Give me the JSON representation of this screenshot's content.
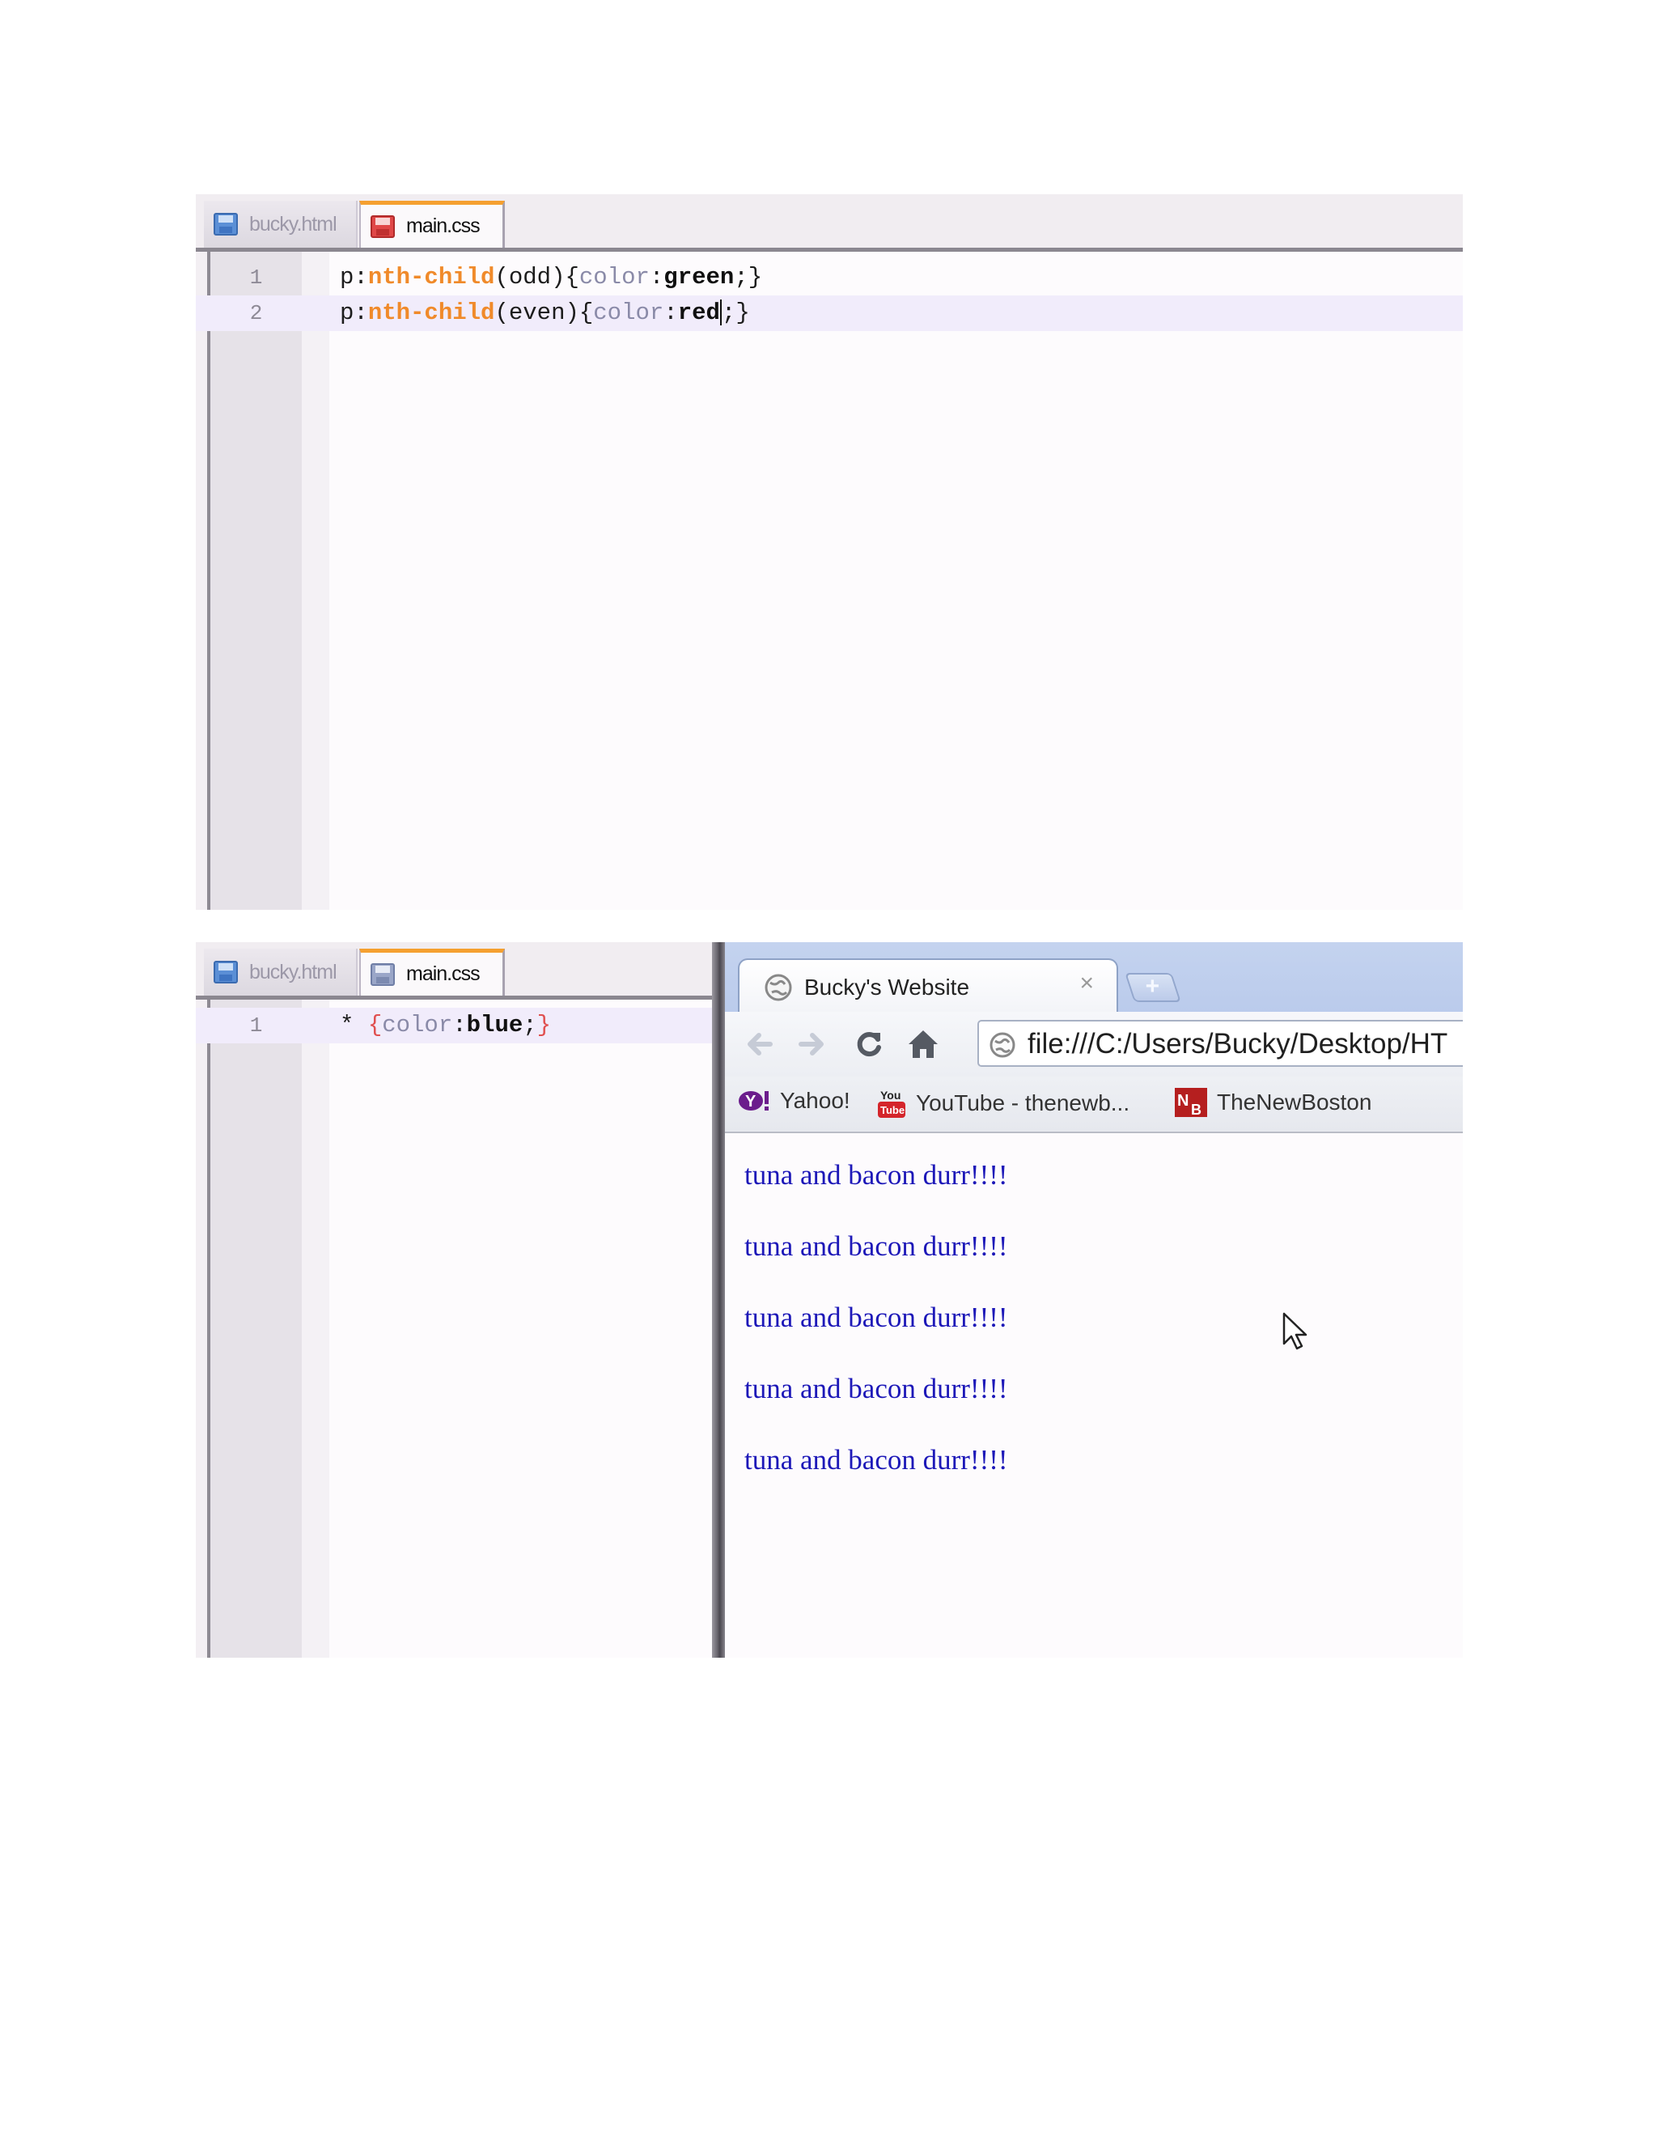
{
  "top_editor": {
    "tabs": [
      {
        "label": "bucky.html",
        "active": false
      },
      {
        "label": "main.css",
        "active": true
      }
    ],
    "lines": [
      {
        "number": "1",
        "tokens": [
          {
            "t": "p:",
            "c": "sel"
          },
          {
            "t": "nth-child",
            "c": "pseudo"
          },
          {
            "t": "(odd)",
            "c": "paren"
          },
          {
            "t": "{",
            "c": "brace"
          },
          {
            "t": "color",
            "c": "prop"
          },
          {
            "t": ":",
            "c": "sel"
          },
          {
            "t": "green",
            "c": "val"
          },
          {
            "t": ";}",
            "c": "sel"
          }
        ]
      },
      {
        "number": "2",
        "tokens": [
          {
            "t": "p:",
            "c": "sel"
          },
          {
            "t": "nth-child",
            "c": "pseudo"
          },
          {
            "t": "(even)",
            "c": "paren"
          },
          {
            "t": "{",
            "c": "brace"
          },
          {
            "t": "color",
            "c": "prop"
          },
          {
            "t": ":",
            "c": "sel"
          },
          {
            "t": "red",
            "c": "val"
          },
          {
            "t": "|",
            "c": "caret"
          },
          {
            "t": ";}",
            "c": "sel"
          }
        ]
      }
    ]
  },
  "bottom_editor": {
    "tabs": [
      {
        "label": "bucky.html",
        "active": false
      },
      {
        "label": "main.css",
        "active": true
      }
    ],
    "lines": [
      {
        "number": "1",
        "tokens": [
          {
            "t": "* ",
            "c": "sel"
          },
          {
            "t": "{",
            "c": "bracered"
          },
          {
            "t": "color",
            "c": "prop"
          },
          {
            "t": ":",
            "c": "sel"
          },
          {
            "t": "blue",
            "c": "val"
          },
          {
            "t": ";",
            "c": "sel"
          },
          {
            "t": "}",
            "c": "bracered"
          }
        ]
      }
    ]
  },
  "browser": {
    "tab_title": "Bucky's Website",
    "tab_close": "×",
    "new_tab": "+",
    "address": "file:///C:/Users/Bucky/Desktop/HT",
    "bookmarks": [
      {
        "label": "Yahoo!",
        "icon": "yahoo-icon"
      },
      {
        "label": "YouTube - thenewb...",
        "icon": "youtube-icon"
      },
      {
        "label": "TheNewBoston",
        "icon": "newboston-icon"
      }
    ],
    "paragraphs": [
      "tuna and bacon durr!!!!",
      "tuna and bacon durr!!!!",
      "tuna and bacon durr!!!!",
      "tuna and bacon durr!!!!",
      "tuna and bacon durr!!!!"
    ],
    "paragraph_color": "#1d18b8"
  },
  "colors": {
    "active_tab_accent": "#f5a030",
    "pseudo_class": "#f08a2a",
    "current_line": "#f1ecfb"
  }
}
